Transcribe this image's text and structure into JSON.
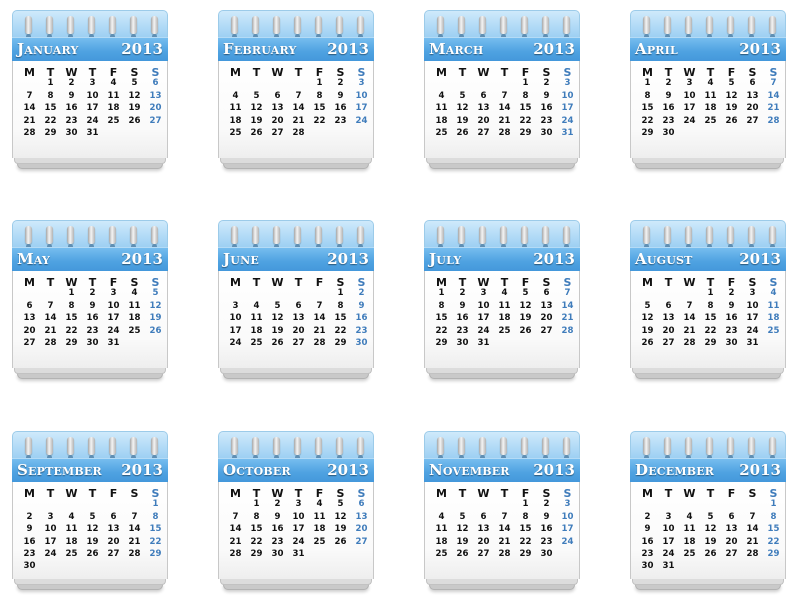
{
  "year": "2013",
  "weekday_headers": [
    "M",
    "T",
    "W",
    "T",
    "F",
    "S",
    "S"
  ],
  "colors": {
    "header_blue": "#4fa2e1",
    "sunday_blue": "#3f7cbb",
    "ring_tab": "#a9d6f5"
  },
  "months": [
    {
      "name": "January",
      "first_weekday": 1,
      "days": 31
    },
    {
      "name": "February",
      "first_weekday": 4,
      "days": 28
    },
    {
      "name": "March",
      "first_weekday": 4,
      "days": 31
    },
    {
      "name": "April",
      "first_weekday": 0,
      "days": 30
    },
    {
      "name": "May",
      "first_weekday": 2,
      "days": 31
    },
    {
      "name": "June",
      "first_weekday": 5,
      "days": 30
    },
    {
      "name": "July",
      "first_weekday": 0,
      "days": 31
    },
    {
      "name": "August",
      "first_weekday": 3,
      "days": 31
    },
    {
      "name": "September",
      "first_weekday": 6,
      "days": 30
    },
    {
      "name": "October",
      "first_weekday": 1,
      "days": 31
    },
    {
      "name": "November",
      "first_weekday": 4,
      "days": 30
    },
    {
      "name": "December",
      "first_weekday": 6,
      "days": 31
    }
  ]
}
